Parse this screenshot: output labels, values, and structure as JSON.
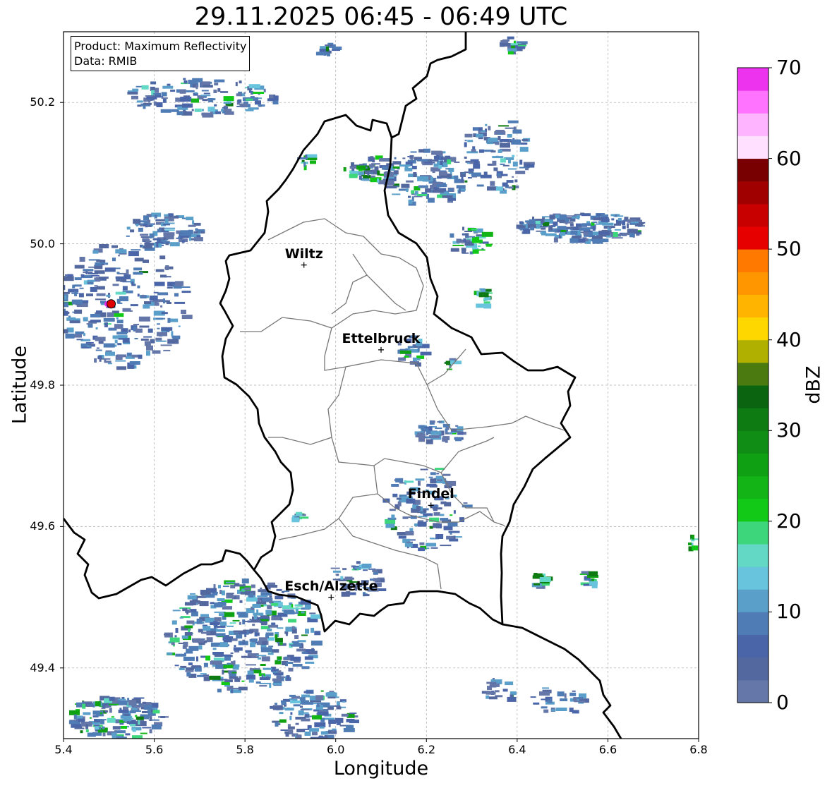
{
  "title": "29.11.2025 06:45 - 06:49 UTC",
  "info": {
    "product": "Product: Maximum Reflectivity",
    "data": "Data: RMIB"
  },
  "axes": {
    "xlabel": "Longitude",
    "ylabel": "Latitude",
    "xticks": [
      "5.4",
      "5.6",
      "5.8",
      "6.0",
      "6.2",
      "6.4",
      "6.6",
      "6.8"
    ],
    "yticks": [
      "50.2",
      "50.0",
      "49.8",
      "49.6",
      "49.4"
    ],
    "xlim": [
      5.4,
      6.8
    ],
    "ylim": [
      49.3,
      50.3
    ],
    "grid": true
  },
  "cities": [
    {
      "name": "Wiltz",
      "lon": 5.93,
      "lat": 49.97
    },
    {
      "name": "Ettelbruck",
      "lon": 6.1,
      "lat": 49.85
    },
    {
      "name": "Findel",
      "lon": 6.21,
      "lat": 49.63
    },
    {
      "name": "Esch/Alzette",
      "lon": 5.99,
      "lat": 49.5
    }
  ],
  "radar_site": {
    "lon": 5.505,
    "lat": 49.915
  },
  "colorbar": {
    "label": "dBZ",
    "ticks": [
      "0",
      "10",
      "20",
      "30",
      "40",
      "50",
      "60",
      "70"
    ],
    "min": 0,
    "max": 70,
    "colors": [
      "#6577a8",
      "#5468a0",
      "#4a66a8",
      "#4f7cb5",
      "#5a9fca",
      "#68c3dd",
      "#62d8c5",
      "#3dd67a",
      "#12c918",
      "#12b416",
      "#10a014",
      "#108d14",
      "#0e7a12",
      "#0b6510",
      "#4a7a10",
      "#b0b000",
      "#ffd700",
      "#ffb400",
      "#ff9600",
      "#ff7800",
      "#e60000",
      "#c80000",
      "#a00000",
      "#780000",
      "#ffe0ff",
      "#ffb4ff",
      "#ff73ff",
      "#ee33ee"
    ]
  }
}
